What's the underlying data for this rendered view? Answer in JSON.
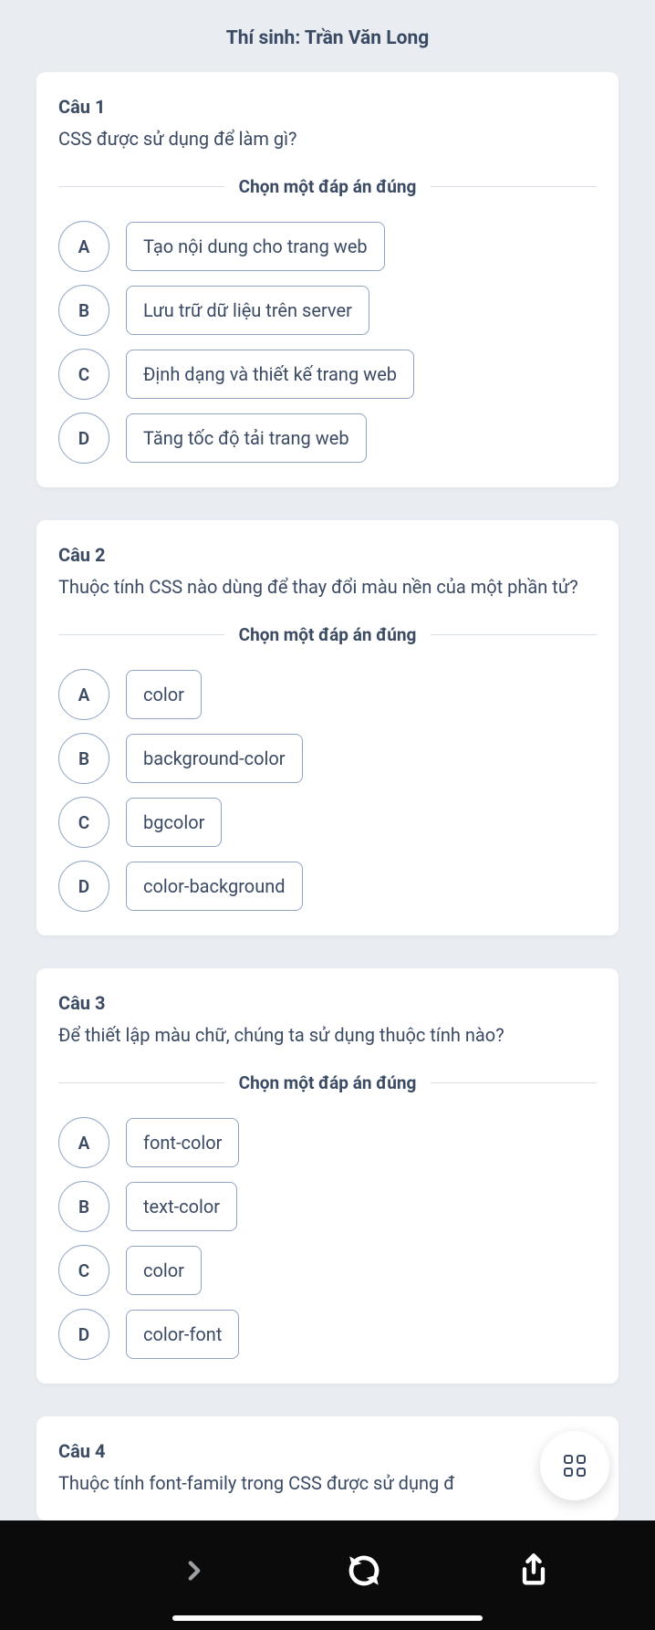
{
  "header": "Thí sinh: Trần Văn Long",
  "instruction_label": "Chọn một đáp án đúng",
  "questions": [
    {
      "number": "Câu 1",
      "text": "CSS được sử dụng để làm gì?",
      "options": [
        {
          "letter": "A",
          "text": "Tạo nội dung cho trang web"
        },
        {
          "letter": "B",
          "text": "Lưu trữ dữ liệu trên server"
        },
        {
          "letter": "C",
          "text": "Định dạng và thiết kế trang web"
        },
        {
          "letter": "D",
          "text": "Tăng tốc độ tải trang web"
        }
      ]
    },
    {
      "number": "Câu 2",
      "text": "Thuộc tính CSS nào dùng để thay đổi màu nền của một phần tử?",
      "options": [
        {
          "letter": "A",
          "text": "color"
        },
        {
          "letter": "B",
          "text": "background-color"
        },
        {
          "letter": "C",
          "text": "bgcolor"
        },
        {
          "letter": "D",
          "text": "color-background"
        }
      ]
    },
    {
      "number": "Câu 3",
      "text": "Để thiết lập màu chữ, chúng ta sử dụng thuộc tính nào?",
      "options": [
        {
          "letter": "A",
          "text": "font-color"
        },
        {
          "letter": "B",
          "text": "text-color"
        },
        {
          "letter": "C",
          "text": "color"
        },
        {
          "letter": "D",
          "text": "color-font"
        }
      ]
    },
    {
      "number": "Câu 4",
      "text": "Thuộc tính font-family trong CSS được sử dụng đ",
      "options": []
    }
  ]
}
